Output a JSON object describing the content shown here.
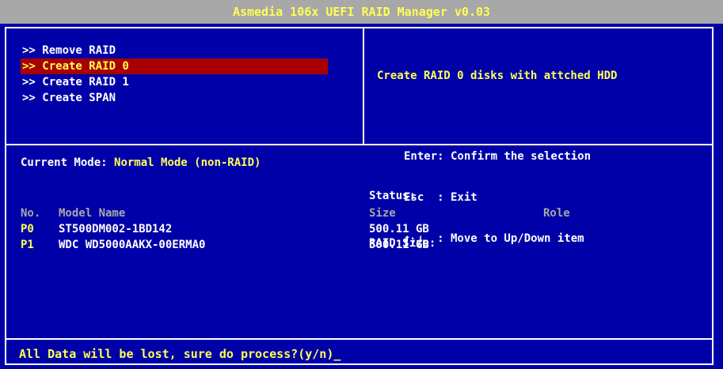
{
  "title": "Asmedia 106x UEFI RAID Manager v0.03",
  "menu": {
    "items": [
      {
        "label": ">> Remove RAID",
        "selected": false
      },
      {
        "label": ">> Create RAID 0",
        "selected": true
      },
      {
        "label": ">> Create RAID 1",
        "selected": false
      },
      {
        "label": ">> Create SPAN",
        "selected": false
      }
    ]
  },
  "help": {
    "title": "Create RAID 0 disks with attched HDD",
    "lines": [
      "Enter: Confirm the selection",
      "Esc  : Exit",
      "↑,↓  : Move to Up/Down item"
    ]
  },
  "mode": {
    "label": "Current Mode:",
    "value": "Normal Mode (non-RAID)"
  },
  "status": {
    "status_label": "Status:",
    "size_label": "RAID Size:"
  },
  "table": {
    "headers": {
      "no": "No.",
      "model": "Model Name",
      "size": "Size",
      "role": "Role"
    },
    "rows": [
      {
        "port": "P0",
        "model": "ST500DM002-1BD142",
        "size": "500.11 GB"
      },
      {
        "port": "P1",
        "model": "WDC WD5000AAKX-00ERMA0",
        "size": "500.11 GB"
      }
    ]
  },
  "prompt": "All Data will be lost, sure do process?(y/n)_",
  "colors": {
    "background": "#0000a8",
    "title_bar": "#a8a8a8",
    "highlight": "#ffff55",
    "selection": "#a80000"
  }
}
